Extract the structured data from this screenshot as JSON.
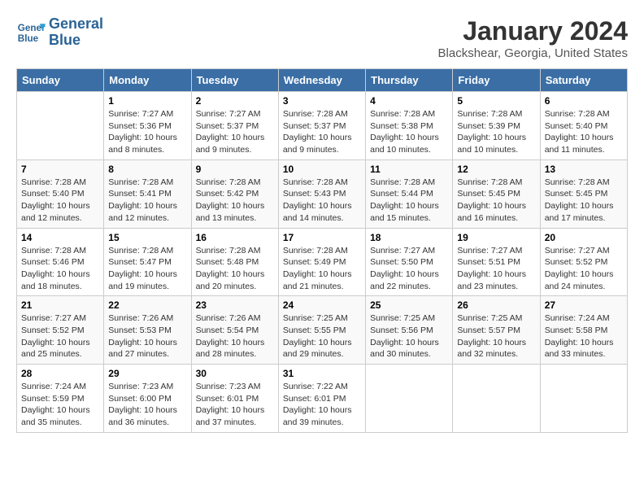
{
  "header": {
    "logo_line1": "General",
    "logo_line2": "Blue",
    "month_title": "January 2024",
    "location": "Blackshear, Georgia, United States"
  },
  "weekdays": [
    "Sunday",
    "Monday",
    "Tuesday",
    "Wednesday",
    "Thursday",
    "Friday",
    "Saturday"
  ],
  "weeks": [
    [
      {
        "day": "",
        "info": ""
      },
      {
        "day": "1",
        "info": "Sunrise: 7:27 AM\nSunset: 5:36 PM\nDaylight: 10 hours\nand 8 minutes."
      },
      {
        "day": "2",
        "info": "Sunrise: 7:27 AM\nSunset: 5:37 PM\nDaylight: 10 hours\nand 9 minutes."
      },
      {
        "day": "3",
        "info": "Sunrise: 7:28 AM\nSunset: 5:37 PM\nDaylight: 10 hours\nand 9 minutes."
      },
      {
        "day": "4",
        "info": "Sunrise: 7:28 AM\nSunset: 5:38 PM\nDaylight: 10 hours\nand 10 minutes."
      },
      {
        "day": "5",
        "info": "Sunrise: 7:28 AM\nSunset: 5:39 PM\nDaylight: 10 hours\nand 10 minutes."
      },
      {
        "day": "6",
        "info": "Sunrise: 7:28 AM\nSunset: 5:40 PM\nDaylight: 10 hours\nand 11 minutes."
      }
    ],
    [
      {
        "day": "7",
        "info": "Sunrise: 7:28 AM\nSunset: 5:40 PM\nDaylight: 10 hours\nand 12 minutes."
      },
      {
        "day": "8",
        "info": "Sunrise: 7:28 AM\nSunset: 5:41 PM\nDaylight: 10 hours\nand 12 minutes."
      },
      {
        "day": "9",
        "info": "Sunrise: 7:28 AM\nSunset: 5:42 PM\nDaylight: 10 hours\nand 13 minutes."
      },
      {
        "day": "10",
        "info": "Sunrise: 7:28 AM\nSunset: 5:43 PM\nDaylight: 10 hours\nand 14 minutes."
      },
      {
        "day": "11",
        "info": "Sunrise: 7:28 AM\nSunset: 5:44 PM\nDaylight: 10 hours\nand 15 minutes."
      },
      {
        "day": "12",
        "info": "Sunrise: 7:28 AM\nSunset: 5:45 PM\nDaylight: 10 hours\nand 16 minutes."
      },
      {
        "day": "13",
        "info": "Sunrise: 7:28 AM\nSunset: 5:45 PM\nDaylight: 10 hours\nand 17 minutes."
      }
    ],
    [
      {
        "day": "14",
        "info": "Sunrise: 7:28 AM\nSunset: 5:46 PM\nDaylight: 10 hours\nand 18 minutes."
      },
      {
        "day": "15",
        "info": "Sunrise: 7:28 AM\nSunset: 5:47 PM\nDaylight: 10 hours\nand 19 minutes."
      },
      {
        "day": "16",
        "info": "Sunrise: 7:28 AM\nSunset: 5:48 PM\nDaylight: 10 hours\nand 20 minutes."
      },
      {
        "day": "17",
        "info": "Sunrise: 7:28 AM\nSunset: 5:49 PM\nDaylight: 10 hours\nand 21 minutes."
      },
      {
        "day": "18",
        "info": "Sunrise: 7:27 AM\nSunset: 5:50 PM\nDaylight: 10 hours\nand 22 minutes."
      },
      {
        "day": "19",
        "info": "Sunrise: 7:27 AM\nSunset: 5:51 PM\nDaylight: 10 hours\nand 23 minutes."
      },
      {
        "day": "20",
        "info": "Sunrise: 7:27 AM\nSunset: 5:52 PM\nDaylight: 10 hours\nand 24 minutes."
      }
    ],
    [
      {
        "day": "21",
        "info": "Sunrise: 7:27 AM\nSunset: 5:52 PM\nDaylight: 10 hours\nand 25 minutes."
      },
      {
        "day": "22",
        "info": "Sunrise: 7:26 AM\nSunset: 5:53 PM\nDaylight: 10 hours\nand 27 minutes."
      },
      {
        "day": "23",
        "info": "Sunrise: 7:26 AM\nSunset: 5:54 PM\nDaylight: 10 hours\nand 28 minutes."
      },
      {
        "day": "24",
        "info": "Sunrise: 7:25 AM\nSunset: 5:55 PM\nDaylight: 10 hours\nand 29 minutes."
      },
      {
        "day": "25",
        "info": "Sunrise: 7:25 AM\nSunset: 5:56 PM\nDaylight: 10 hours\nand 30 minutes."
      },
      {
        "day": "26",
        "info": "Sunrise: 7:25 AM\nSunset: 5:57 PM\nDaylight: 10 hours\nand 32 minutes."
      },
      {
        "day": "27",
        "info": "Sunrise: 7:24 AM\nSunset: 5:58 PM\nDaylight: 10 hours\nand 33 minutes."
      }
    ],
    [
      {
        "day": "28",
        "info": "Sunrise: 7:24 AM\nSunset: 5:59 PM\nDaylight: 10 hours\nand 35 minutes."
      },
      {
        "day": "29",
        "info": "Sunrise: 7:23 AM\nSunset: 6:00 PM\nDaylight: 10 hours\nand 36 minutes."
      },
      {
        "day": "30",
        "info": "Sunrise: 7:23 AM\nSunset: 6:01 PM\nDaylight: 10 hours\nand 37 minutes."
      },
      {
        "day": "31",
        "info": "Sunrise: 7:22 AM\nSunset: 6:01 PM\nDaylight: 10 hours\nand 39 minutes."
      },
      {
        "day": "",
        "info": ""
      },
      {
        "day": "",
        "info": ""
      },
      {
        "day": "",
        "info": ""
      }
    ]
  ]
}
